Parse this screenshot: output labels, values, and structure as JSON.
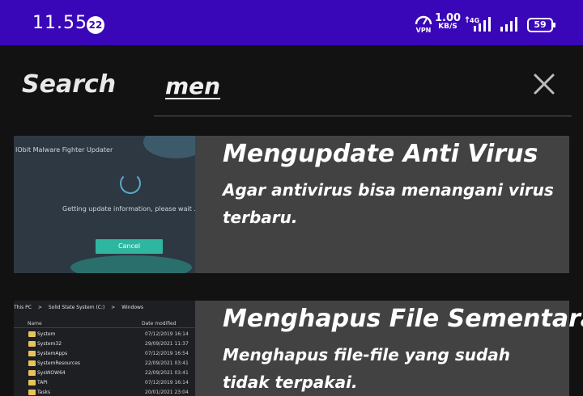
{
  "status_bar": {
    "time": "11.55",
    "notification_count": "22",
    "vpn_label": "VPN",
    "speed_value": "1.00",
    "speed_unit": "KB/S",
    "network_type": "4G",
    "battery": "59"
  },
  "header": {
    "title": "Search",
    "search_value": "men",
    "clear_icon": "close-icon"
  },
  "results": [
    {
      "title": "Mengupdate Anti Virus",
      "description": "Agar antivirus bisa menangani virus terbaru.",
      "thumbnail": {
        "window_title": "IObit Malware Fighter Updater",
        "message": "Getting update information, please wait ...",
        "button": "Cancel"
      }
    },
    {
      "title": "Menghapus File Sementara",
      "description": "Menghapus file-file yang sudah tidak terpakai.",
      "thumbnail": {
        "path": [
          "This PC",
          ">",
          "Solid State System (C:)",
          ">",
          "Windows"
        ],
        "col_name": "Name",
        "col_date": "Date modified",
        "rows": [
          {
            "name": "System",
            "date": "07/12/2019 16:14"
          },
          {
            "name": "System32",
            "date": "29/09/2021 11:37"
          },
          {
            "name": "SystemApps",
            "date": "07/12/2019 16:54"
          },
          {
            "name": "SystemResources",
            "date": "22/09/2021 03:41"
          },
          {
            "name": "SysWOW64",
            "date": "22/09/2021 03:41"
          },
          {
            "name": "TAPI",
            "date": "07/12/2019 16:14"
          },
          {
            "name": "Tasks",
            "date": "20/01/2021 23:04"
          }
        ]
      }
    }
  ],
  "colors": {
    "status_bar": "#3a07b8",
    "background": "#121212",
    "card": "#424242",
    "accent_button": "#2fb6a0"
  }
}
